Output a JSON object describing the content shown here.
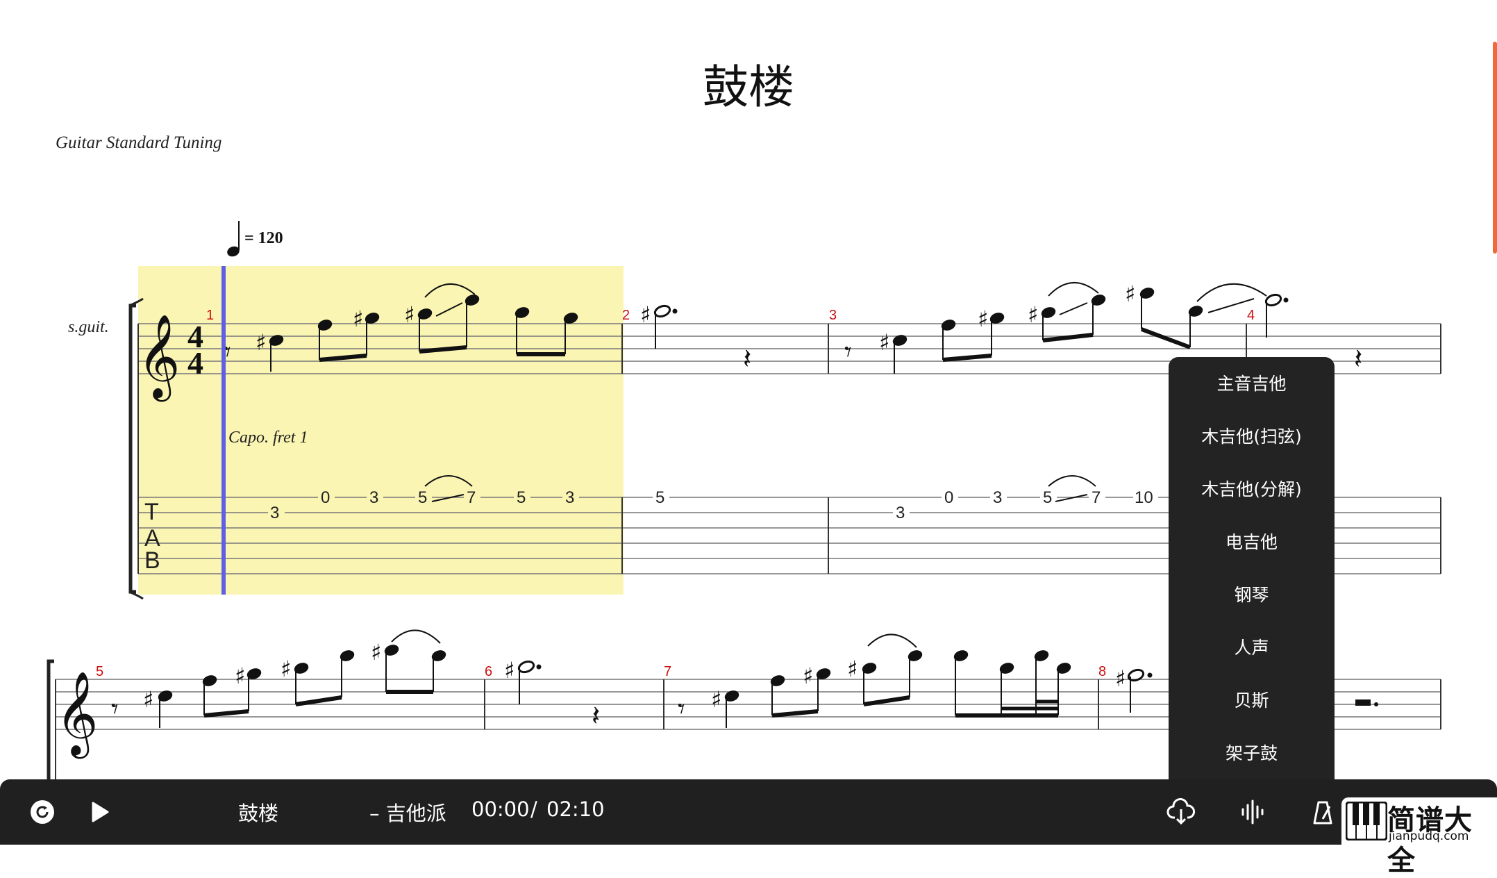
{
  "score": {
    "title": "鼓楼",
    "subtitle": "Guitar Standard Tuning",
    "tempo_text": "= 120",
    "instrument_abbrev": "s.guit.",
    "capo_text": "Capo. fret 1",
    "time_signature": "4/4",
    "tab_clef": [
      "T",
      "A",
      "B"
    ],
    "measure_numbers": [
      "1",
      "2",
      "3",
      "4",
      "5",
      "6",
      "7",
      "8"
    ],
    "tab_numbers_row1": [
      "3",
      "0",
      "3",
      "5",
      "7",
      "5",
      "3",
      "5",
      "3",
      "0",
      "3",
      "5",
      "7",
      "10"
    ]
  },
  "track_menu": {
    "items": [
      "主音吉他",
      "木吉他(扫弦)",
      "木吉他(分解)",
      "电吉他",
      "钢琴",
      "人声",
      "贝斯",
      "架子鼓"
    ]
  },
  "player": {
    "song_title": "鼓楼",
    "source": "– 吉他派",
    "current_time": "00:00",
    "separator": "/",
    "total_time": "02:10",
    "icons": [
      "loop-icon",
      "play-icon",
      "download-icon",
      "waveform-icon",
      "metronome-icon"
    ]
  },
  "watermark": {
    "name": "简谱大全",
    "url": "jianpudq.com"
  },
  "colors": {
    "highlight": "#fbf5b3",
    "cursor": "#5f5fe6",
    "measure_number": "#cc1010",
    "menu_bg": "#232323",
    "bar_bg": "#202020",
    "scroll_accent": "#f2683d"
  }
}
